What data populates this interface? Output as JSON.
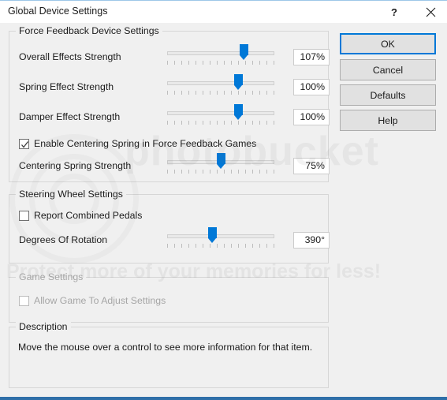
{
  "window": {
    "title": "Global Device Settings",
    "help_icon": "question-mark-icon",
    "close_icon": "close-icon"
  },
  "groups": {
    "force_feedback": {
      "title": "Force Feedback Device Settings",
      "rows": [
        {
          "label": "Overall Effects Strength",
          "value": "107%",
          "percent": 71
        },
        {
          "label": "Spring Effect Strength",
          "value": "100%",
          "percent": 66
        },
        {
          "label": "Damper Effect Strength",
          "value": "100%",
          "percent": 66
        }
      ],
      "checkbox": {
        "label": "Enable Centering Spring in Force Feedback Games",
        "checked": true
      },
      "centering": {
        "label": "Centering Spring Strength",
        "value": "75%",
        "percent": 50
      }
    },
    "steering_wheel": {
      "title": "Steering Wheel Settings",
      "checkbox": {
        "label": "Report Combined Pedals",
        "checked": false
      },
      "rotation": {
        "label": "Degrees Of Rotation",
        "value": "390°",
        "percent": 42
      }
    },
    "game_settings": {
      "title": "Game Settings",
      "checkbox": {
        "label": "Allow Game To Adjust Settings",
        "checked": false,
        "disabled": true
      }
    },
    "description": {
      "title": "Description",
      "text": "Move the mouse over a control to see more information for that item."
    }
  },
  "buttons": [
    {
      "label": "OK",
      "default": true
    },
    {
      "label": "Cancel",
      "default": false
    },
    {
      "label": "Defaults",
      "default": false
    },
    {
      "label": "Help",
      "default": false
    }
  ],
  "watermark": {
    "word": "photobucket",
    "tagline": "Protect more of your memories for less!"
  },
  "colors": {
    "accent": "#0078d7",
    "window_bg": "#f0f0f0",
    "titlebar_bg": "#ffffff",
    "button_bg": "#e1e1e1",
    "bottom_bar": "#2f6fa8"
  }
}
